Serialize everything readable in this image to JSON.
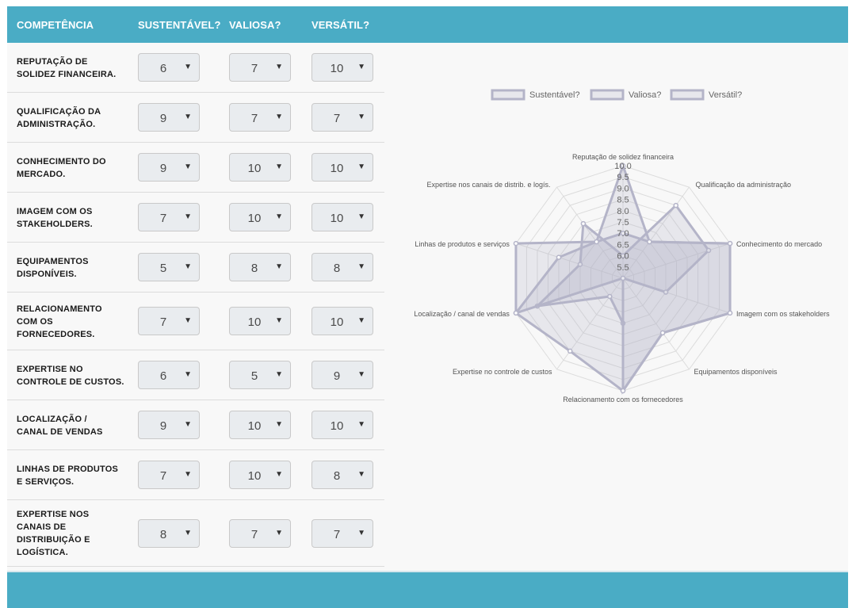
{
  "header": {
    "col_competencia": "COMPETÊNCIA",
    "col_sustentavel": "SUSTENTÁVEL?",
    "col_valiosa": "VALIOSA?",
    "col_versatil": "VERSÁTIL?"
  },
  "rows": [
    {
      "label": "REPUTAÇÃO DE\nSOLIDEZ FINANCEIRA.",
      "s": "6",
      "v": "7",
      "x": "10"
    },
    {
      "label": "QUALIFICAÇÃO DA\nADMINISTRAÇÃO.",
      "s": "9",
      "v": "7",
      "x": "7"
    },
    {
      "label": "CONHECIMENTO DO\nMERCADO.",
      "s": "9",
      "v": "10",
      "x": "10"
    },
    {
      "label": "IMAGEM COM OS\nSTAKEHOLDERS.",
      "s": "7",
      "v": "10",
      "x": "10"
    },
    {
      "label": "EQUIPAMENTOS\nDISPONÍVEIS.",
      "s": "5",
      "v": "8",
      "x": "8"
    },
    {
      "label": "RELACIONAMENTO\nCOM OS\nFORNECEDORES.",
      "s": "7",
      "v": "10",
      "x": "10"
    },
    {
      "label": "EXPERTISE NO\nCONTROLE DE CUSTOS.",
      "s": "6",
      "v": "5",
      "x": "9"
    },
    {
      "label": "LOCALIZAÇÃO /\nCANAL DE VENDAS",
      "s": "9",
      "v": "10",
      "x": "10"
    },
    {
      "label": "LINHAS DE PRODUTOS\nE SERVIÇOS.",
      "s": "7",
      "v": "10",
      "x": "8"
    },
    {
      "label": "EXPERTISE NOS\nCANAIS DE\nDISTRIBUIÇÃO E\nLOGÍSTICA.",
      "s": "8",
      "v": "7",
      "x": "7"
    }
  ],
  "arrow_glyph": "▼",
  "colors": {
    "header_bg": "#4aacc5",
    "series_stroke": "#b4b4c8",
    "series_fill": "rgba(180,180,200,0.25)"
  },
  "chart_data": {
    "type": "radar",
    "categories": [
      "Reputação de solidez financeira",
      "Qualificação da administração",
      "Conhecimento do mercado",
      "Imagem com os stakeholders",
      "Equipamentos disponíveis",
      "Relacionamento com os fornecedores",
      "Expertise no controle de custos",
      "Localização / canal de vendas",
      "Linhas de produtos e serviços",
      "Expertise nos canais de distrib. e logís."
    ],
    "series": [
      {
        "name": "Sustentável?",
        "values": [
          6,
          9,
          9,
          7,
          5,
          7,
          6,
          9,
          7,
          8
        ]
      },
      {
        "name": "Valiosa?",
        "values": [
          7,
          7,
          10,
          10,
          8,
          10,
          5,
          10,
          10,
          7
        ]
      },
      {
        "name": "Versátil?",
        "values": [
          10,
          7,
          10,
          10,
          8,
          10,
          9,
          10,
          8,
          7
        ]
      }
    ],
    "r_min": 5.0,
    "r_max": 10.0,
    "ticks": [
      "5.5",
      "6.0",
      "6.5",
      "7.0",
      "7.5",
      "8.0",
      "8.5",
      "9.0",
      "9.5",
      "10.0"
    ],
    "legend_position": "top"
  }
}
